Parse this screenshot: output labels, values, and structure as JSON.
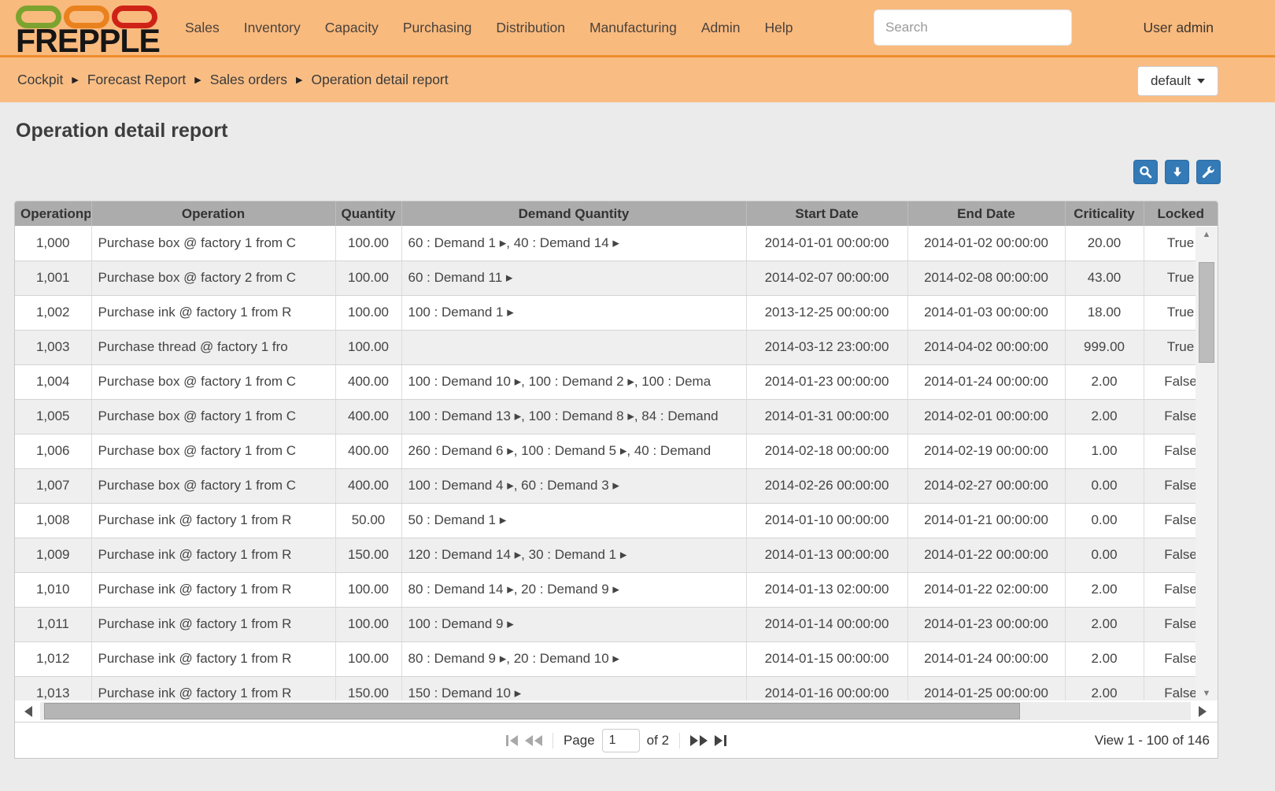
{
  "navbar": {
    "brand": "FREPPLE",
    "logo_colors": {
      "green": "#7ca32f",
      "orange": "#e9821e",
      "red": "#cf2217"
    },
    "menu": [
      "Sales",
      "Inventory",
      "Capacity",
      "Purchasing",
      "Distribution",
      "Manufacturing",
      "Admin",
      "Help"
    ],
    "search_placeholder": "Search",
    "user": "User admin"
  },
  "breadcrumbs": [
    "Cockpit",
    "Forecast Report",
    "Sales orders",
    "Operation detail report"
  ],
  "view_selector": {
    "label": "default"
  },
  "page": {
    "title": "Operation detail report"
  },
  "toolbar": {
    "buttons": [
      {
        "name": "search",
        "icon": "magnifier-icon"
      },
      {
        "name": "download",
        "icon": "arrow-down-icon"
      },
      {
        "name": "customize",
        "icon": "wrench-icon"
      }
    ],
    "accent_color": "#337ab7"
  },
  "table": {
    "columns": [
      "Operationplan",
      "Operation",
      "Quantity",
      "Demand Quantity",
      "Start Date",
      "End Date",
      "Criticality",
      "Locked"
    ],
    "col_keys": [
      "operationplan",
      "operation",
      "quantity",
      "demand-quantity",
      "start-date",
      "end-date",
      "criticality",
      "locked"
    ],
    "align": [
      "ta-c",
      "ta-l",
      "ta-c",
      "ta-l",
      "ta-c",
      "ta-c",
      "ta-c",
      "ta-c"
    ],
    "rows": [
      [
        "1,000",
        "Purchase box @ factory 1 from C",
        "100.00",
        "60 : Demand 1 ▸, 40 : Demand 14 ▸",
        "2014-01-01 00:00:00",
        "2014-01-02 00:00:00",
        "20.00",
        "True"
      ],
      [
        "1,001",
        "Purchase box @ factory 2 from C",
        "100.00",
        "60 : Demand 11 ▸",
        "2014-02-07 00:00:00",
        "2014-02-08 00:00:00",
        "43.00",
        "True"
      ],
      [
        "1,002",
        "Purchase ink @ factory 1 from R",
        "100.00",
        "100 : Demand 1 ▸",
        "2013-12-25 00:00:00",
        "2014-01-03 00:00:00",
        "18.00",
        "True"
      ],
      [
        "1,003",
        "Purchase thread @ factory 1 fro",
        "100.00",
        "",
        "2014-03-12 23:00:00",
        "2014-04-02 00:00:00",
        "999.00",
        "True"
      ],
      [
        "1,004",
        "Purchase box @ factory 1 from C",
        "400.00",
        "100 : Demand 10 ▸, 100 : Demand 2 ▸, 100 : Dema",
        "2014-01-23 00:00:00",
        "2014-01-24 00:00:00",
        "2.00",
        "False"
      ],
      [
        "1,005",
        "Purchase box @ factory 1 from C",
        "400.00",
        "100 : Demand 13 ▸, 100 : Demand 8 ▸, 84 : Demand",
        "2014-01-31 00:00:00",
        "2014-02-01 00:00:00",
        "2.00",
        "False"
      ],
      [
        "1,006",
        "Purchase box @ factory 1 from C",
        "400.00",
        "260 : Demand 6 ▸, 100 : Demand 5 ▸, 40 : Demand",
        "2014-02-18 00:00:00",
        "2014-02-19 00:00:00",
        "1.00",
        "False"
      ],
      [
        "1,007",
        "Purchase box @ factory 1 from C",
        "400.00",
        "100 : Demand 4 ▸, 60 : Demand 3 ▸",
        "2014-02-26 00:00:00",
        "2014-02-27 00:00:00",
        "0.00",
        "False"
      ],
      [
        "1,008",
        "Purchase ink @ factory 1 from R",
        "50.00",
        "50 : Demand 1 ▸",
        "2014-01-10 00:00:00",
        "2014-01-21 00:00:00",
        "0.00",
        "False"
      ],
      [
        "1,009",
        "Purchase ink @ factory 1 from R",
        "150.00",
        "120 : Demand 14 ▸, 30 : Demand 1 ▸",
        "2014-01-13 00:00:00",
        "2014-01-22 00:00:00",
        "0.00",
        "False"
      ],
      [
        "1,010",
        "Purchase ink @ factory 1 from R",
        "100.00",
        "80 : Demand 14 ▸, 20 : Demand 9 ▸",
        "2014-01-13 02:00:00",
        "2014-01-22 02:00:00",
        "2.00",
        "False"
      ],
      [
        "1,011",
        "Purchase ink @ factory 1 from R",
        "100.00",
        "100 : Demand 9 ▸",
        "2014-01-14 00:00:00",
        "2014-01-23 00:00:00",
        "2.00",
        "False"
      ],
      [
        "1,012",
        "Purchase ink @ factory 1 from R",
        "100.00",
        "80 : Demand 9 ▸, 20 : Demand 10 ▸",
        "2014-01-15 00:00:00",
        "2014-01-24 00:00:00",
        "2.00",
        "False"
      ],
      [
        "1,013",
        "Purchase ink @ factory 1 from R",
        "150.00",
        "150 : Demand 10 ▸",
        "2014-01-16 00:00:00",
        "2014-01-25 00:00:00",
        "2.00",
        "False"
      ]
    ]
  },
  "pager": {
    "page_label": "Page",
    "page_value": "1",
    "of_label": "of 2",
    "view_label": "View 1 - 100 of 146"
  }
}
